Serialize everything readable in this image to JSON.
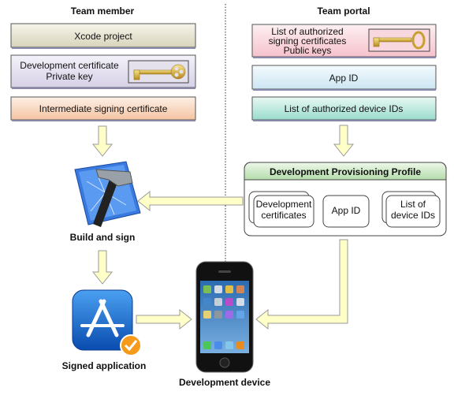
{
  "team_member": {
    "title": "Team member",
    "xcode_project": "Xcode project",
    "dev_cert_line1": "Development certificate",
    "dev_cert_line2": "Private key",
    "intermediate": "Intermediate signing certificate",
    "build_label": "Build and sign",
    "signed_label": "Signed application"
  },
  "team_portal": {
    "title": "Team portal",
    "certs_line1": "List of authorized",
    "certs_line2": "signing certificates",
    "certs_line3": "Public keys",
    "app_id": "App ID",
    "device_ids": "List of authorized device IDs"
  },
  "profile": {
    "title": "Development Provisioning Profile",
    "certs_line1": "Development",
    "certs_line2": "certificates",
    "app_id": "App ID",
    "devices_line1": "List of",
    "devices_line2": "device IDs"
  },
  "device": {
    "label": "Development device"
  },
  "icons": [
    "key-icon",
    "xcode-icon",
    "app-store-icon",
    "checkmark-badge-icon",
    "iphone-icon"
  ],
  "colors": {
    "arrow_fill": "#ffffc8",
    "profile_header": "#c8e6c0"
  }
}
